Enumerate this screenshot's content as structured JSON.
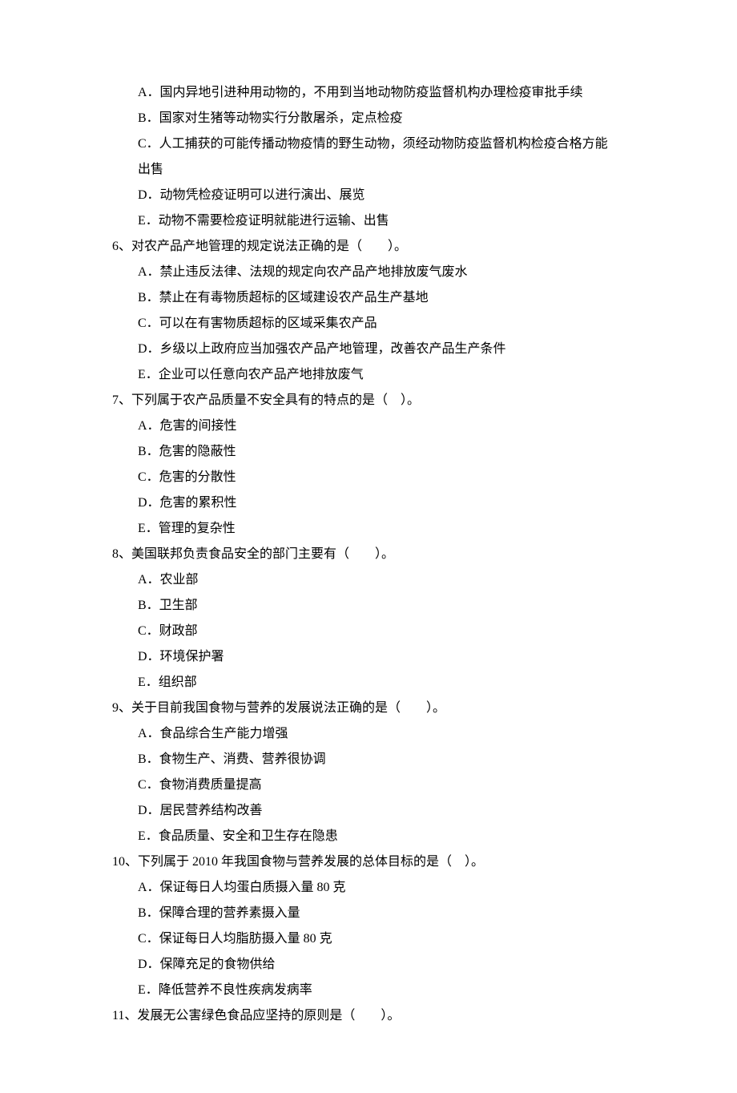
{
  "lines": [
    {
      "cls": "option-line",
      "text": "A．国内异地引进种用动物的，不用到当地动物防疫监督机构办理检疫审批手续"
    },
    {
      "cls": "option-line",
      "text": "B．国家对生猪等动物实行分散屠杀，定点检疫"
    },
    {
      "cls": "option-line",
      "text": "C．人工捕获的可能传播动物疫情的野生动物，须经动物防疫监督机构检疫合格方能"
    },
    {
      "cls": "wrap-line",
      "text": "出售"
    },
    {
      "cls": "option-line",
      "text": "D．动物凭检疫证明可以进行演出、展览"
    },
    {
      "cls": "option-line",
      "text": "E．动物不需要检疫证明就能进行运输、出售"
    },
    {
      "cls": "question-line",
      "text": "6、对农产品产地管理的规定说法正确的是（　　）。"
    },
    {
      "cls": "option-line",
      "text": "A．禁止违反法律、法规的规定向农产品产地排放废气废水"
    },
    {
      "cls": "option-line",
      "text": "B．禁止在有毒物质超标的区域建设农产品生产基地"
    },
    {
      "cls": "option-line",
      "text": "C．可以在有害物质超标的区域采集农产品"
    },
    {
      "cls": "option-line",
      "text": "D．乡级以上政府应当加强农产品产地管理，改善农产品生产条件"
    },
    {
      "cls": "option-line",
      "text": "E．企业可以任意向农产品产地排放废气"
    },
    {
      "cls": "question-line",
      "text": "7、下列属于农产品质量不安全具有的特点的是（　）。"
    },
    {
      "cls": "option-line",
      "text": "A．危害的间接性"
    },
    {
      "cls": "option-line",
      "text": "B．危害的隐蔽性"
    },
    {
      "cls": "option-line",
      "text": "C．危害的分散性"
    },
    {
      "cls": "option-line",
      "text": "D．危害的累积性"
    },
    {
      "cls": "option-line",
      "text": "E．管理的复杂性"
    },
    {
      "cls": "question-line",
      "text": "8、美国联邦负责食品安全的部门主要有（　　）。"
    },
    {
      "cls": "option-line",
      "text": "A．农业部"
    },
    {
      "cls": "option-line",
      "text": "B．卫生部"
    },
    {
      "cls": "option-line",
      "text": "C．财政部"
    },
    {
      "cls": "option-line",
      "text": "D．环境保护署"
    },
    {
      "cls": "option-line",
      "text": "E．组织部"
    },
    {
      "cls": "question-line",
      "text": "9、关于目前我国食物与营养的发展说法正确的是（　　）。"
    },
    {
      "cls": "option-line",
      "text": "A．食品综合生产能力增强"
    },
    {
      "cls": "option-line",
      "text": "B．食物生产、消费、营养很协调"
    },
    {
      "cls": "option-line",
      "text": "C．食物消费质量提高"
    },
    {
      "cls": "option-line",
      "text": "D．居民营养结构改善"
    },
    {
      "cls": "option-line",
      "text": "E．食品质量、安全和卫生存在隐患"
    },
    {
      "cls": "question-line",
      "text": "10、下列属于 2010 年我国食物与营养发展的总体目标的是（　）。"
    },
    {
      "cls": "option-line",
      "text": "A．保证每日人均蛋白质摄入量 80 克"
    },
    {
      "cls": "option-line",
      "text": "B．保障合理的营养素摄入量"
    },
    {
      "cls": "option-line",
      "text": "C．保证每日人均脂肪摄入量 80 克"
    },
    {
      "cls": "option-line",
      "text": "D．保障充足的食物供给"
    },
    {
      "cls": "option-line",
      "text": "E．降低营养不良性疾病发病率"
    },
    {
      "cls": "question-line",
      "text": "11、发展无公害绿色食品应坚持的原则是（　　）。"
    }
  ]
}
